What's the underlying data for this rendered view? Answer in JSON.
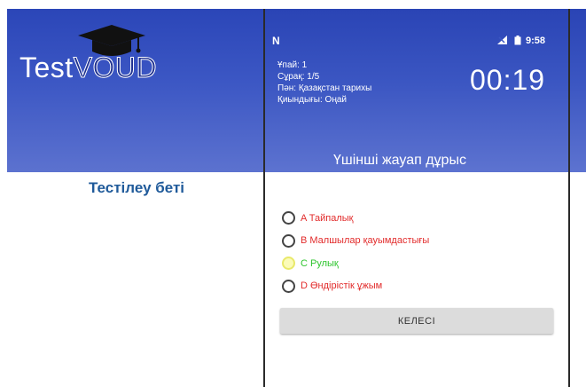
{
  "left_panel": {
    "logo_part1": "Test",
    "logo_part2": "VOUD",
    "caption": "Тестілеу беті"
  },
  "status_bar": {
    "left_icon": "N",
    "signal_icon": "signal-icon",
    "battery_icon": "battery-icon",
    "time": "9:58"
  },
  "quiz_info": {
    "score": "Ұпай: 1",
    "question": "Сұрақ: 1/5",
    "subject": "Пән: Қазақстан тарихы",
    "difficulty": "Қиындығы: Оңай"
  },
  "timer": "00:19",
  "feedback": "Үшінші жауап  дұрыс",
  "options": [
    {
      "label": "A Тайпалық",
      "state": "wrong",
      "selected": false
    },
    {
      "label": "B Малшылар қауымдастығы",
      "state": "wrong",
      "selected": false
    },
    {
      "label": "C Рулық",
      "state": "correct",
      "selected": true
    },
    {
      "label": "D Өндірістік ұжым",
      "state": "wrong",
      "selected": false
    }
  ],
  "next_button": "КЕЛЕСІ",
  "colors": {
    "header_blue": "#3b56c2",
    "wrong": "#e22b2b",
    "correct": "#2ec52e",
    "caption": "#1f5a9a"
  }
}
